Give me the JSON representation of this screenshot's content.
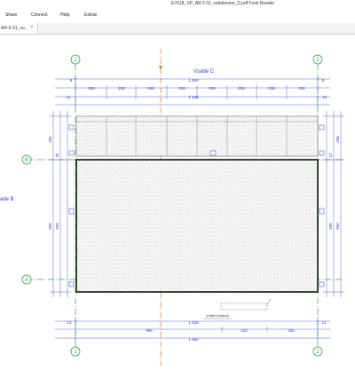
{
  "window": {
    "title": "E7618_SP_AR 5 01_vzdalenost_D.pdf  Foxit Reader"
  },
  "menu": {
    "items": [
      "Share",
      "Connect",
      "Help",
      "Extras"
    ]
  },
  "tab": {
    "label": "AR-5-31_vu..."
  },
  "drawing": {
    "grid": {
      "axis_1": "1",
      "axis_2": "2",
      "axis_A": "A",
      "axis_B": "B"
    },
    "facade_c": "Vsade C",
    "facade_b": "ade B",
    "top_overall": "1 650",
    "top_segments": [
      "206",
      "236",
      "206",
      "206",
      "206",
      "206",
      "236",
      "206"
    ],
    "top_inner": "1 630",
    "top_side": "11",
    "top_small": "8",
    "bottom_inner": "1 628",
    "bottom_overall": "1 650",
    "bottom_segments": [
      "995",
      "310",
      "345"
    ],
    "bottom_small": "11",
    "left_upper": "266",
    "left_lower": "950",
    "right_upper": "266",
    "right_lower": "950",
    "side_small": [
      "32",
      "12",
      "338"
    ],
    "note": "Vnitřní kontury"
  },
  "colors": {
    "grid": "#2aa84a",
    "dim": "#2b3fd6",
    "axis": "#ee7a22",
    "wall": "#2e4a2a"
  }
}
